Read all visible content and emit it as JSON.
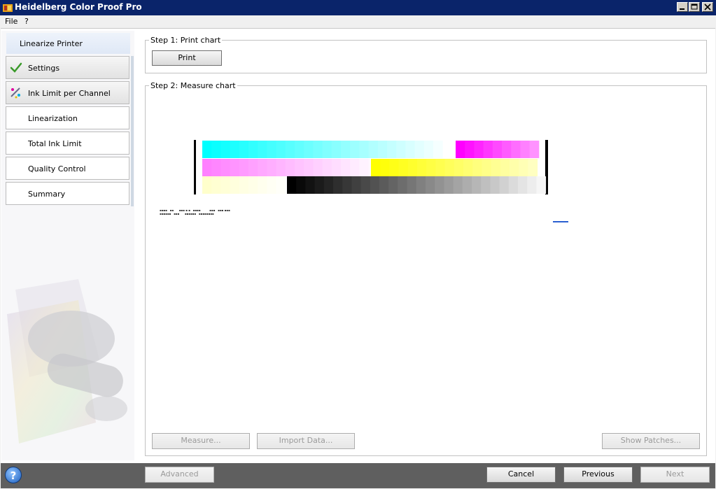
{
  "window": {
    "title": "Heidelberg Color Proof Pro"
  },
  "menu": {
    "items": [
      "File",
      "?"
    ]
  },
  "sidebar": {
    "header": "Linearize Printer",
    "items": [
      {
        "label": "Settings",
        "icon": "checkmark-icon",
        "state": "done"
      },
      {
        "label": "Ink Limit per Channel",
        "icon": "ink-limit-icon",
        "state": "current"
      },
      {
        "label": "Linearization",
        "icon": "",
        "state": "pending"
      },
      {
        "label": "Total Ink Limit",
        "icon": "",
        "state": "pending"
      },
      {
        "label": "Quality Control",
        "icon": "",
        "state": "pending"
      },
      {
        "label": "Summary",
        "icon": "",
        "state": "pending"
      }
    ]
  },
  "step1": {
    "legend": "Step 1: Print chart",
    "print_label": "Print"
  },
  "step2": {
    "legend": "Step 2: Measure chart",
    "measure_label": "Measure...",
    "import_label": "Import Data...",
    "show_patches_label": "Show Patches..."
  },
  "footer": {
    "advanced_label": "Advanced",
    "cancel_label": "Cancel",
    "previous_label": "Previous",
    "next_label": "Next"
  },
  "colors": {
    "titlebar": "#0a246a",
    "cyan": "#00ffff",
    "magenta": "#ff00ff",
    "yellow": "#ffff00",
    "black": "#000000"
  }
}
